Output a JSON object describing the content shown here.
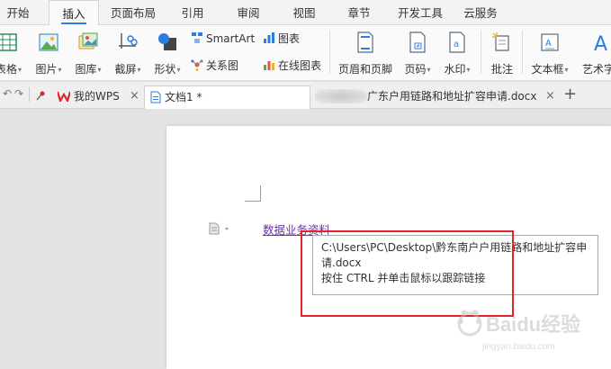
{
  "menu": {
    "tabs": [
      "开始",
      "插入",
      "页面布局",
      "引用",
      "审阅",
      "视图",
      "章节",
      "开发工具",
      "云服务"
    ],
    "active_index": 1
  },
  "ribbon": {
    "table": "表格",
    "picture": "图片",
    "gallery": "图库",
    "screenshot": "截屏",
    "shapes": "形状",
    "smartart": "SmartArt",
    "chart": "图表",
    "relation": "关系图",
    "online_chart": "在线图表",
    "header_footer": "页眉和页脚",
    "page_number": "页码",
    "watermark": "水印",
    "annotation": "批注",
    "textbox": "文本框",
    "wordart": "艺术字"
  },
  "tabs": {
    "wps": "我的WPS",
    "doc1": "文档1 *",
    "doc_partial": "广东户用链路和地址扩容申请.docx",
    "close": "×",
    "new": "+"
  },
  "document": {
    "link_text": "数据业务资料",
    "tooltip_line1": "C:\\Users\\PC\\Desktop\\黔东南户户用链路和地址扩容申",
    "tooltip_line2": "请.docx",
    "tooltip_line3": "按住 CTRL 并单击鼠标以跟踪链接"
  },
  "watermark": {
    "brand": "Baidu经验",
    "url": "jingyan.baidu.com"
  },
  "colors": {
    "accent": "#2b7de1",
    "highlight_box": "#e0242a",
    "link": "#6b2fa8"
  }
}
